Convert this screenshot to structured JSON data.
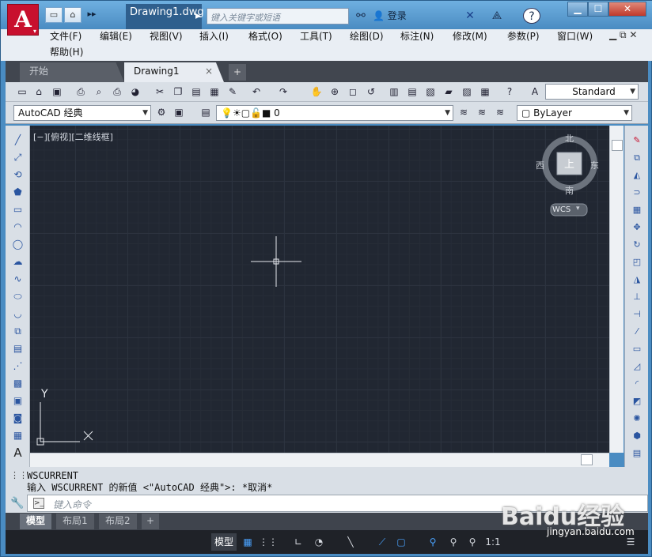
{
  "window": {
    "doc_title": "Drawing1.dwg",
    "search_placeholder": "键入关键字或短语",
    "login": "登录",
    "min": "▁",
    "max": "☐",
    "close": "✕"
  },
  "app_button": {
    "letter": "A",
    "corner": "▾"
  },
  "quick_access": [
    "▭",
    "⌂",
    "▸▸"
  ],
  "menu": [
    "文件(F)",
    "编辑(E)",
    "视图(V)",
    "插入(I)",
    "格式(O)",
    "工具(T)",
    "绘图(D)",
    "标注(N)",
    "修改(M)",
    "参数(P)",
    "窗口(W)",
    "帮助(H)"
  ],
  "tabs": {
    "start": "开始",
    "drawing": "Drawing1",
    "close": "×",
    "add": "+"
  },
  "toolbar": {
    "text_style": "Standard",
    "workspace": "AutoCAD 经典",
    "layer": "0",
    "color": "ByLayer"
  },
  "canvas": {
    "view_label": "[−][俯视][二维线框]",
    "compass": {
      "n": "北",
      "s": "南",
      "e": "东",
      "w": "西",
      "top": "上"
    },
    "wcs": "WCS",
    "ucs_x": "X",
    "ucs_y": "Y"
  },
  "command": {
    "history": [
      "WSCURRENT",
      "输入 WSCURRENT 的新值 <\"AutoCAD 经典\">: *取消*"
    ],
    "placeholder": "键入命令"
  },
  "layout_tabs": [
    "模型",
    "布局1",
    "布局2",
    "+"
  ],
  "status": {
    "model": "模型",
    "scale": "1:1"
  },
  "watermark": {
    "brand": "Baidu经验",
    "url": "jingyan.baidu.com"
  },
  "colors": {
    "canvas": "#212732",
    "accent": "#c8102e"
  }
}
